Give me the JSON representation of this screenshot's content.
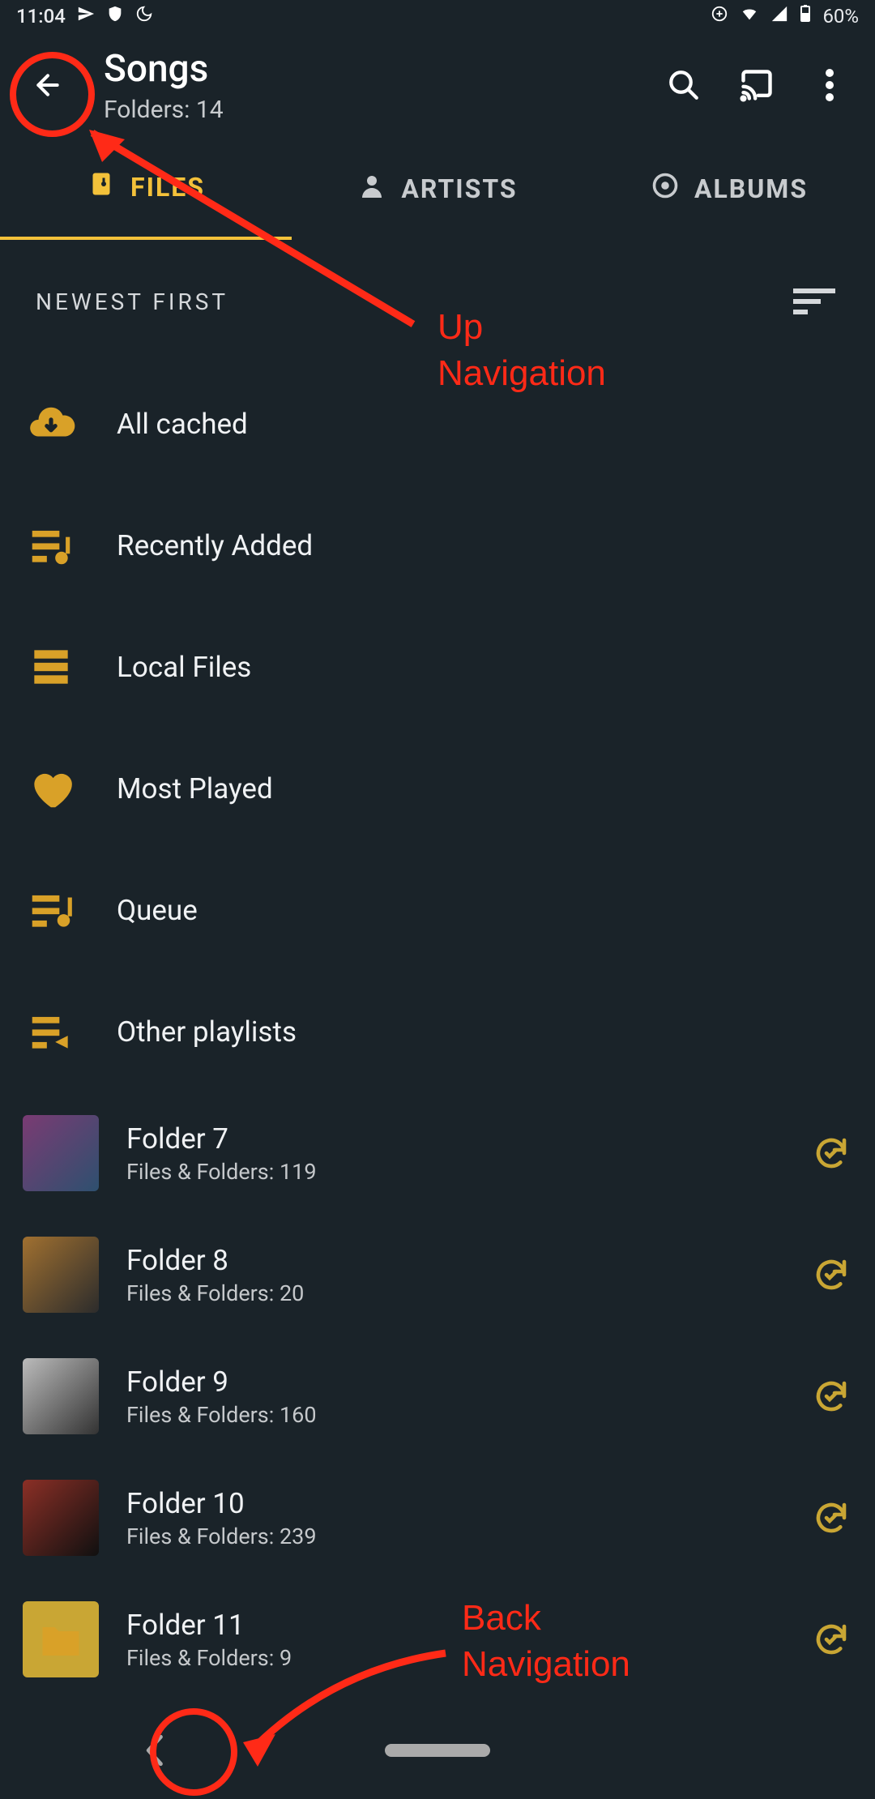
{
  "status": {
    "time": "11:04",
    "battery": "60%"
  },
  "appbar": {
    "title": "Songs",
    "subtitle": "Folders: 14"
  },
  "tabs": {
    "files": "FILES",
    "artists": "ARTISTS",
    "albums": "ALBUMS"
  },
  "sort": {
    "label": "NEWEST FIRST"
  },
  "items": {
    "all_cached": "All cached",
    "recently_added": "Recently Added",
    "local_files": "Local Files",
    "most_played": "Most Played",
    "queue": "Queue",
    "other_playlists": "Other playlists"
  },
  "folders": [
    {
      "name": "Folder 7",
      "sub": "Files & Folders: 119"
    },
    {
      "name": "Folder 8",
      "sub": "Files & Folders: 20"
    },
    {
      "name": "Folder 9",
      "sub": "Files & Folders: 160"
    },
    {
      "name": "Folder 10",
      "sub": "Files & Folders: 239"
    },
    {
      "name": "Folder 11",
      "sub": "Files & Folders: 9"
    }
  ],
  "annotation": {
    "up_nav": "Up\nNavigation",
    "back_nav": "Back\nNavigation"
  }
}
